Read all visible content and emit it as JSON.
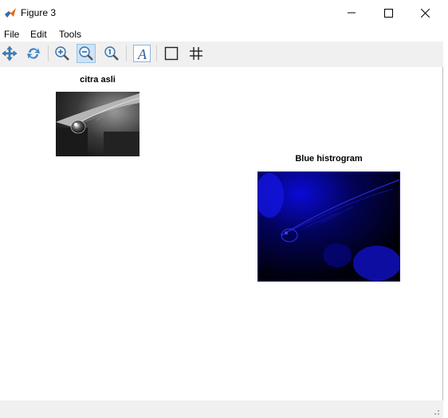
{
  "window": {
    "title": "Figure 3"
  },
  "menu": {
    "file": "File",
    "edit": "Edit",
    "tools": "Tools"
  },
  "toolbar": {
    "buttons": [
      {
        "name": "pan",
        "icon": "pan-icon"
      },
      {
        "name": "rotate",
        "icon": "rotate-icon"
      },
      {
        "name": "zoom-in",
        "icon": "zoom-in-icon"
      },
      {
        "name": "zoom-out",
        "icon": "zoom-out-icon",
        "active": true
      },
      {
        "name": "zoom-reset",
        "icon": "zoom-reset-icon"
      },
      {
        "name": "insert-text",
        "icon": "text-icon"
      },
      {
        "name": "box",
        "icon": "box-icon"
      },
      {
        "name": "grid",
        "icon": "grid-icon"
      }
    ]
  },
  "axes": [
    {
      "title": "citra asli",
      "content": "grayscale water-drop-on-leaf photo"
    },
    {
      "title": "Blue histrogram",
      "content": "blue channel of water-drop-on-leaf photo"
    }
  ],
  "colors": {
    "toolbar_bg": "#f0f0f0",
    "active_button": "#cfe3f5",
    "blue_channel": "#0000ff"
  }
}
